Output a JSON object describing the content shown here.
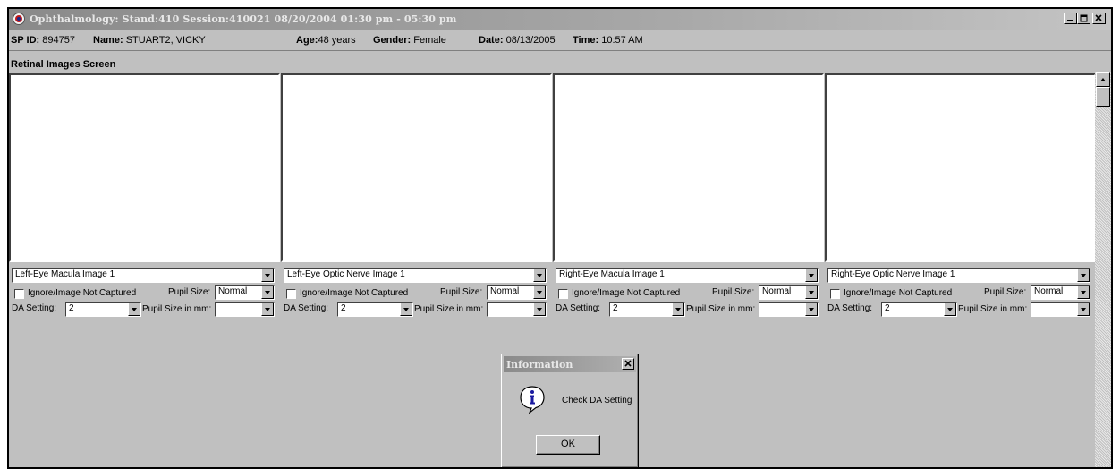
{
  "window": {
    "title": "Ophthalmology: Stand:410 Session:410021 08/20/2004 01:30 pm - 05:30 pm"
  },
  "participant": {
    "sp_id_label": "SP ID:",
    "sp_id": "894757",
    "name_label": "Name:",
    "name": "STUART2, VICKY",
    "age_label": "Age:",
    "age": "48 years",
    "gender_label": "Gender:",
    "gender": "Female",
    "date_label": "Date:",
    "date": "08/13/2005",
    "time_label": "Time:",
    "time": "10:57 AM"
  },
  "screen_title": "Retinal Images Screen",
  "panels": [
    {
      "image_label": "Left-Eye Macula Image 1",
      "ignore_label": "Ignore/Image Not Captured",
      "pupil_size_label": "Pupil Size:",
      "pupil_size": "Normal",
      "da_label": "DA Setting:",
      "da_value": "2",
      "pupil_mm_label": "Pupil Size in mm:",
      "pupil_mm": ""
    },
    {
      "image_label": "Left-Eye Optic Nerve Image 1",
      "ignore_label": "Ignore/Image Not Captured",
      "pupil_size_label": "Pupil Size:",
      "pupil_size": "Normal",
      "da_label": "DA Setting:",
      "da_value": "2",
      "pupil_mm_label": "Pupil Size in mm:",
      "pupil_mm": ""
    },
    {
      "image_label": "Right-Eye Macula Image 1",
      "ignore_label": "Ignore/Image Not Captured",
      "pupil_size_label": "Pupil Size:",
      "pupil_size": "Normal",
      "da_label": "DA Setting:",
      "da_value": "2",
      "pupil_mm_label": "Pupil Size in mm:",
      "pupil_mm": ""
    },
    {
      "image_label": "Right-Eye Optic Nerve Image 1",
      "ignore_label": "Ignore/Image Not Captured",
      "pupil_size_label": "Pupil Size:",
      "pupil_size": "Normal",
      "da_label": "DA Setting:",
      "da_value": "2",
      "pupil_mm_label": "Pupil Size in mm:",
      "pupil_mm": ""
    }
  ],
  "dialog": {
    "title": "Information",
    "message": "Check DA Setting",
    "ok_label": "OK",
    "icon": "information-icon"
  },
  "icons": {
    "app": "eye-app-icon",
    "minimize": "minimize-icon",
    "maximize": "maximize-icon",
    "close": "close-icon"
  }
}
